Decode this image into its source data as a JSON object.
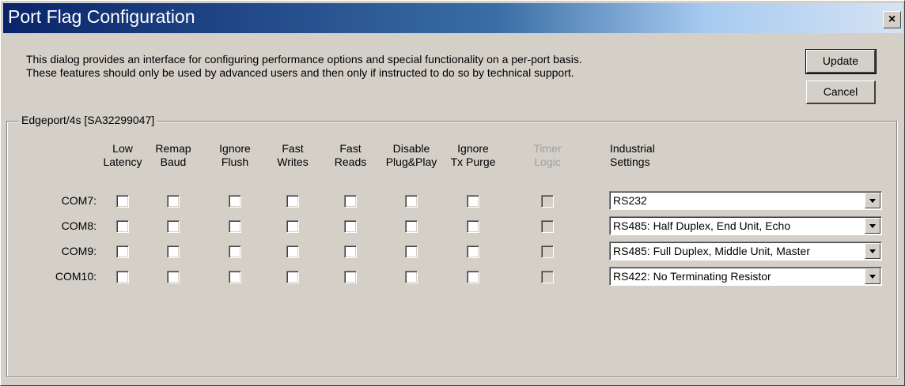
{
  "window": {
    "title": "Port Flag Configuration",
    "close_glyph": "×"
  },
  "description": {
    "line1": "This dialog provides an interface for configuring performance options and special functionality on a per-port basis.",
    "line2": "These features should only be used by advanced users and then only if instructed to do so by technical support."
  },
  "buttons": {
    "update": "Update",
    "cancel": "Cancel"
  },
  "group": {
    "label": "Edgeport/4s [SA32299047]"
  },
  "columns": [
    {
      "line1": "Low",
      "line2": "Latency",
      "disabled": false
    },
    {
      "line1": "Remap",
      "line2": "Baud",
      "disabled": false
    },
    {
      "line1": "Ignore",
      "line2": "Flush",
      "disabled": false
    },
    {
      "line1": "Fast",
      "line2": "Writes",
      "disabled": false
    },
    {
      "line1": "Fast",
      "line2": "Reads",
      "disabled": false
    },
    {
      "line1": "Disable",
      "line2": "Plug&Play",
      "disabled": false
    },
    {
      "line1": "Ignore",
      "line2": "Tx Purge",
      "disabled": false
    },
    {
      "line1": "Timer",
      "line2": "Logic",
      "disabled": true
    }
  ],
  "industrial_header": {
    "line1": "Industrial",
    "line2": "Settings"
  },
  "ports": [
    {
      "label": "COM7:",
      "setting": "RS232",
      "checked": [
        false,
        false,
        false,
        false,
        false,
        false,
        false,
        false
      ]
    },
    {
      "label": "COM8:",
      "setting": "RS485: Half Duplex, End Unit, Echo",
      "checked": [
        false,
        false,
        false,
        false,
        false,
        false,
        false,
        false
      ]
    },
    {
      "label": "COM9:",
      "setting": "RS485: Full Duplex, Middle Unit, Master",
      "checked": [
        false,
        false,
        false,
        false,
        false,
        false,
        false,
        false
      ]
    },
    {
      "label": "COM10:",
      "setting": "RS422: No Terminating Resistor",
      "checked": [
        false,
        false,
        false,
        false,
        false,
        false,
        false,
        false
      ]
    }
  ]
}
